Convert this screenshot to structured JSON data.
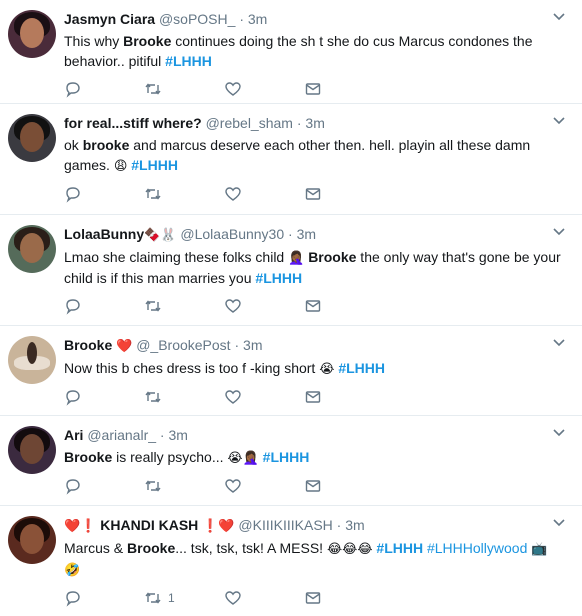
{
  "tweets": [
    {
      "name": "Jasmyn Ciara",
      "handle": "@soPOSH_",
      "time": "3m",
      "avatar_color": "#4a2b3a",
      "body_parts": [
        {
          "t": "This why "
        },
        {
          "b": "Brooke"
        },
        {
          "t": " continues doing the sh  t she do cus Marcus condones the behavior.. pitiful   "
        },
        {
          "h": "#LHHH"
        }
      ]
    },
    {
      "name": "for real...stiff where?",
      "handle": "@rebel_sham",
      "time": "3m",
      "avatar_color": "#3a3a40",
      "body_parts": [
        {
          "t": "ok "
        },
        {
          "b": "brooke"
        },
        {
          "t": " and marcus deserve each other then. hell. playin all these damn games. "
        },
        {
          "e": "😩"
        },
        {
          "t": " "
        },
        {
          "h": "#LHHH"
        }
      ]
    },
    {
      "name": "LolaaBunny",
      "name_emoji": "🍫🐰",
      "handle": "@LolaaBunny30",
      "time": "3m",
      "avatar_color": "#556b5a",
      "body_parts": [
        {
          "t": "Lmao she claiming these folks child "
        },
        {
          "e": "🤦🏾‍♀️"
        },
        {
          "t": " "
        },
        {
          "b": "Brooke"
        },
        {
          "t": " the only way that's gone be your child is if this man marries you "
        },
        {
          "h": "#LHHH"
        }
      ]
    },
    {
      "name": "Brooke",
      "name_emoji": "❤️",
      "handle": "@_BrookePost",
      "time": "3m",
      "avatar_color": "#c9b49a",
      "body_parts": [
        {
          "t": "Now this b  ches dress is too f  -king short "
        },
        {
          "e": "😭"
        },
        {
          "t": " "
        },
        {
          "h": "#LHHH"
        }
      ]
    },
    {
      "name": "Ari",
      "handle": "@arianalr_",
      "time": "3m",
      "avatar_color": "#3b2a3f",
      "body_parts": [
        {
          "b": "Brooke"
        },
        {
          "t": " is really psycho... "
        },
        {
          "e": "😭🤦🏾‍♀️"
        },
        {
          "t": " "
        },
        {
          "h": "#LHHH"
        }
      ]
    },
    {
      "name": "KHANDI KASH",
      "name_prefix_emoji": "❤️❗",
      "name_emoji": "❗❤️",
      "handle": "@KIIIKIIIKASH",
      "time": "3m",
      "avatar_color": "#5a2a1f",
      "body_parts": [
        {
          "t": "Marcus & "
        },
        {
          "b": "Brooke"
        },
        {
          "t": "... tsk, tsk, tsk! A MESS! "
        },
        {
          "e": "😂😂😂"
        },
        {
          "t": " "
        },
        {
          "h": "#LHHH"
        },
        {
          "t": " "
        },
        {
          "hp": "#LHHHollywood"
        },
        {
          "t": " "
        },
        {
          "e": "📺🤣"
        }
      ],
      "retweets": "1"
    }
  ],
  "colors": {
    "link": "#1b95e0",
    "muted": "#657786",
    "divider": "#e6ecf0"
  },
  "icons": [
    "reply-icon",
    "retweet-icon",
    "like-icon",
    "message-icon",
    "caret-down-icon"
  ]
}
